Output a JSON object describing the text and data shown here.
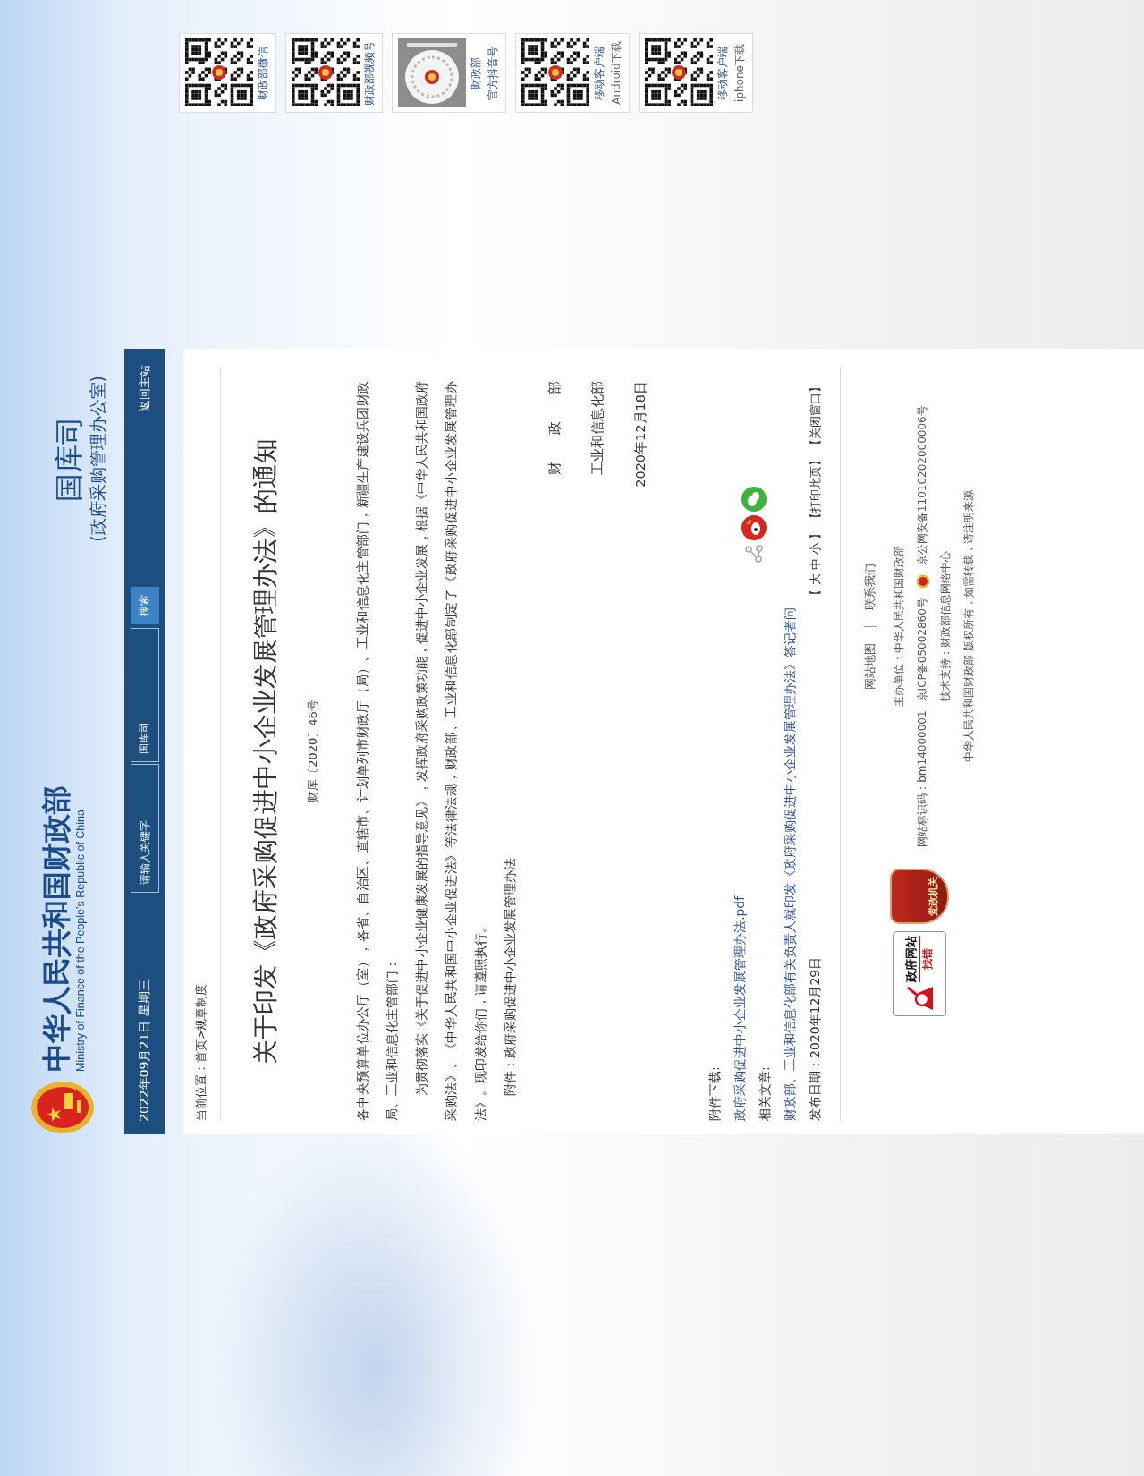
{
  "header": {
    "site_title": "中华人民共和国财政部",
    "site_subtitle": "Ministry of Finance of the People’s Republic of China",
    "department": "国库司",
    "department_note": "(政府采购管理办公室)"
  },
  "nav": {
    "date": "2022年09月21日 星期三",
    "search": {
      "placeholder": "请输入关键字"
    },
    "scope": "国库司",
    "search_button": "搜索",
    "home_link": "返回主站"
  },
  "breadcrumb": "当前位置：首页>规章制度",
  "article": {
    "title": "关于印发《政府采购促进中小企业发展管理办法》的通知",
    "doc_number": "财库〔2020〕46号",
    "paragraphs": [
      {
        "text": "各中央预算单位办公厅（室），各省、自治区、直辖市、计划单列市财政厅（局）、工业和信息化主管部门，新疆生产建设兵团财政局、工业和信息化主管部门：",
        "indent": false
      },
      {
        "text": "为贯彻落实《关于促进中小企业健康发展的指导意见》，发挥政府采购政策功能，促进中小企业发展，根据《中华人民共和国政府采购法》、《中华人民共和国中小企业促进法》等法律法规，财政部、工业和信息化部制定了《政府采购促进中小企业发展管理办法》。现印发给你们，请遵照执行。",
        "indent": true
      },
      {
        "text": "附件：政府采购促进中小企业发展管理办法",
        "indent": true
      }
    ],
    "signatures": [
      "财　　政　　部",
      "工业和信息化部",
      "2020年12月18日"
    ]
  },
  "attachments": {
    "label": "附件下载:",
    "files": [
      "政府采购促进中小企业发展管理办法.pdf"
    ]
  },
  "related": {
    "label": "相关文章:",
    "links": [
      "财政部、工业和信息化部有关负责人就印发《政府采购促进中小企业发展管理办法》答记者问"
    ]
  },
  "publish_date": "发布日期：2020年12月29日",
  "tools": {
    "font_size": "【 大 中 小 】",
    "print": "【打印此页】",
    "close": "【关闭窗口】"
  },
  "footer": {
    "links": [
      "网站地图",
      "联系我们"
    ],
    "sponsor": "主办单位：中华人民共和国财政部",
    "site_code": "网站标识码：bm14000001",
    "icp": "京ICP备05002860号",
    "police": "京公网安备11010202000006号",
    "support": "技术支持：财政部信息网络中心",
    "copyright": "中华人民共和国财政部 版权所有，如需转载，请注明来源",
    "badges": [
      {
        "kind": "error",
        "lines": [
          "政府网站",
          "找错"
        ]
      },
      {
        "kind": "party",
        "lines": [
          "党政机关"
        ]
      }
    ]
  },
  "qr_codes": [
    {
      "kind": "qr",
      "lines": [
        {
          "text": "财政部微信",
          "emphasis": true
        }
      ]
    },
    {
      "kind": "qr",
      "lines": [
        {
          "text": "财政部视频号",
          "emphasis": true
        }
      ]
    },
    {
      "kind": "douyin",
      "lines": [
        {
          "text": "财政部",
          "emphasis": true
        },
        {
          "text": "官方抖音号",
          "emphasis": true
        }
      ]
    },
    {
      "kind": "qr",
      "lines": [
        {
          "text": "移动客户端",
          "emphasis": true
        },
        {
          "text": "Android下载",
          "emphasis": false
        }
      ]
    },
    {
      "kind": "qr",
      "lines": [
        {
          "text": "移动客户端",
          "emphasis": true
        },
        {
          "text": "iphone下载",
          "emphasis": false
        }
      ]
    }
  ]
}
